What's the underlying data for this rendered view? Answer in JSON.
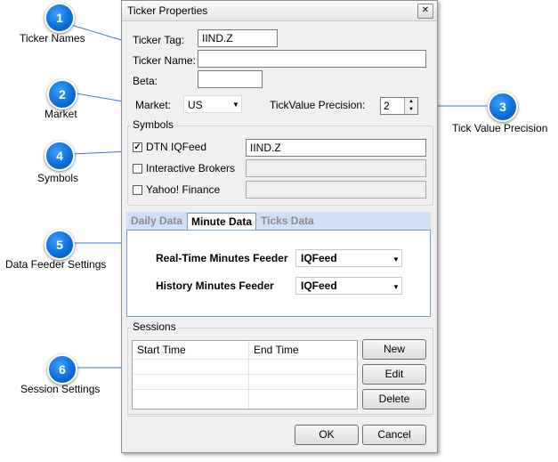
{
  "callouts": [
    {
      "number": "1",
      "label": "Ticker Names"
    },
    {
      "number": "2",
      "label": "Market"
    },
    {
      "number": "3",
      "label": "Tick Value Precision"
    },
    {
      "number": "4",
      "label": "Symbols"
    },
    {
      "number": "5",
      "label": "Data Feeder Settings"
    },
    {
      "number": "6",
      "label": "Session Settings"
    }
  ],
  "window": {
    "title": "Ticker Properties",
    "close_glyph": "✕"
  },
  "fields": {
    "ticker_tag_label": "Ticker Tag:",
    "ticker_tag_value": "IIND.Z",
    "ticker_name_label": "Ticker Name:",
    "ticker_name_value": "",
    "beta_label": "Beta:",
    "beta_value": "",
    "market_label": "Market:",
    "market_value": "US",
    "tick_precision_label": "TickValue Precision:",
    "tick_precision_value": "2"
  },
  "symbols": {
    "legend": "Symbols",
    "items": [
      {
        "label": "DTN IQFeed",
        "checked": true,
        "value": "IIND.Z"
      },
      {
        "label": "Interactive Brokers",
        "checked": false,
        "value": ""
      },
      {
        "label": "Yahoo! Finance",
        "checked": false,
        "value": ""
      }
    ]
  },
  "tabs": {
    "items": [
      "Daily Data",
      "Minute Data",
      "Ticks Data"
    ],
    "active": "Minute Data"
  },
  "feeders": {
    "realtime_label": "Real-Time Minutes Feeder",
    "realtime_value": "IQFeed",
    "history_label": "History Minutes Feeder",
    "history_value": "IQFeed"
  },
  "sessions": {
    "legend": "Sessions",
    "columns": [
      "Start Time",
      "End Time"
    ],
    "new_label": "New",
    "edit_label": "Edit",
    "delete_label": "Delete"
  },
  "footer": {
    "ok_label": "OK",
    "cancel_label": "Cancel"
  },
  "colors": {
    "callout_blue": "#0d6fd8",
    "tab_strip": "#cfe0f3",
    "tab_border": "#7a9cc8"
  }
}
